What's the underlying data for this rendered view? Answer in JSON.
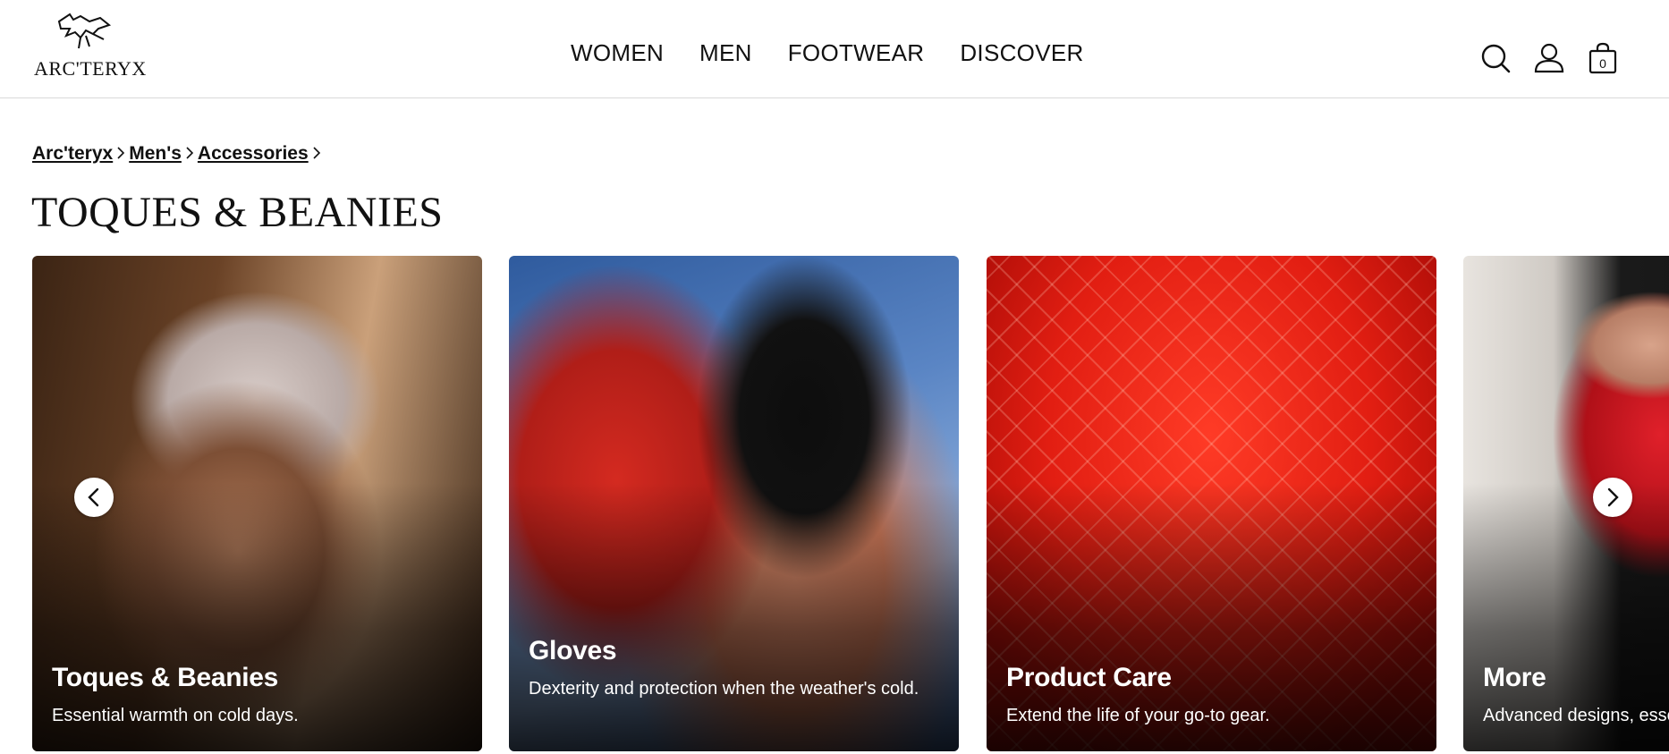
{
  "header": {
    "logo_text": "ARC'TERYX",
    "nav": [
      "WOMEN",
      "MEN",
      "FOOTWEAR",
      "DISCOVER"
    ],
    "bag_count": "0",
    "icons": [
      "search-icon",
      "account-icon",
      "shopping-bag-icon"
    ]
  },
  "breadcrumb": {
    "items": [
      "Arc'teryx",
      "Men's",
      "Accessories"
    ],
    "separator_icon": "chevron-right-icon"
  },
  "page_title": "TOQUES & BEANIES",
  "carousel": {
    "cards": [
      {
        "title": "Toques & Beanies",
        "description": "Essential warmth on cold days."
      },
      {
        "title": "Gloves",
        "description": "Dexterity and protection when the weather's cold."
      },
      {
        "title": "Product Care",
        "description": "Extend the life of your go-to gear."
      },
      {
        "title": "More",
        "description": "Advanced designs, essentials for every adventure."
      }
    ],
    "prev_icon": "chevron-left-icon",
    "next_icon": "chevron-right-icon"
  }
}
